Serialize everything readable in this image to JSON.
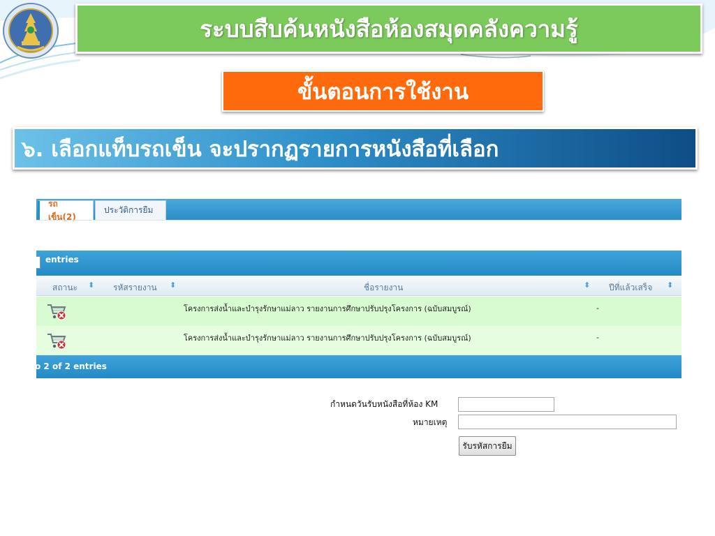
{
  "slide": {
    "title": "ระบบสืบค้นหนังสือห้องสมุดคลังความรู้",
    "step_heading": "ขั้นตอนการใช้งาน",
    "instruction": "๖. เลือกแท็บรถเข็น จะปรากฏรายการหนังสือที่เลือก"
  },
  "app": {
    "tabs": [
      {
        "label": "รถเข็น(2)",
        "active": true
      },
      {
        "label": "ประวัติการยืม",
        "active": false
      }
    ],
    "entries_label": "entries",
    "columns": [
      "สถานะ",
      "รหัสรายงาน",
      "ชื่อรายงาน",
      "ปีที่แล้วเสร็จ"
    ],
    "rows": [
      {
        "status_icon": "cart-remove-icon",
        "code": "",
        "name": "โครงการส่งน้ำและบำรุงรักษาแม่ลาว รายงานการศึกษาปรับปรุงโครงการ (ฉบับสมบูรณ์)",
        "year": "-"
      },
      {
        "status_icon": "cart-remove-icon",
        "code": "",
        "name": "โครงการส่งน้ำและบำรุงรักษาแม่ลาว รายงานการศึกษาปรับปรุงโครงการ (ฉบับสมบูรณ์)",
        "year": "-"
      }
    ],
    "footer_text": "o 2 of 2 entries",
    "form": {
      "date_label": "กำหนดวันรับหนังสือที่ห้อง KM",
      "date_value": "",
      "note_label": "หมายเหตุ",
      "note_value": "",
      "submit_label": "รับรหัสการยืม"
    }
  },
  "colors": {
    "title_bg": "#7cc95c",
    "step_bg": "#ff6a0d",
    "instruction_bg": "#2e8fc9",
    "table_bar": "#2a8ec8",
    "row_bg": "#d9fbd1"
  }
}
